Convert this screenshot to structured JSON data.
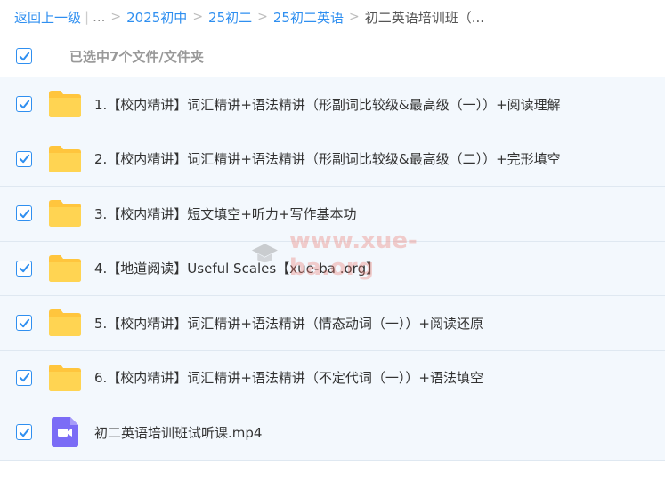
{
  "breadcrumb": {
    "back_label": "返回上一级",
    "pipe": "|",
    "ellipsis": "...",
    "separator": ">",
    "items": [
      "2025初中",
      "25初二",
      "25初二英语"
    ],
    "current": "初二英语培训班（..."
  },
  "selection": {
    "text": "已选中7个文件/文件夹",
    "checked": true
  },
  "files": [
    {
      "name": "1.【校内精讲】词汇精讲+语法精讲（形副词比较级&最高级（一））+阅读理解",
      "type": "folder",
      "checked": true
    },
    {
      "name": "2.【校内精讲】词汇精讲+语法精讲（形副词比较级&最高级（二））+完形填空",
      "type": "folder",
      "checked": true
    },
    {
      "name": "3.【校内精讲】短文填空+听力+写作基本功",
      "type": "folder",
      "checked": true
    },
    {
      "name": "4.【地道阅读】Useful Scales【xue-ba .org】",
      "type": "folder",
      "checked": true
    },
    {
      "name": "5.【校内精讲】词汇精讲+语法精讲（情态动词（一））+阅读还原",
      "type": "folder",
      "checked": true
    },
    {
      "name": "6.【校内精讲】词汇精讲+语法精讲（不定代词（一））+语法填空",
      "type": "folder",
      "checked": true
    },
    {
      "name": "初二英语培训班试听课.mp4",
      "type": "video",
      "checked": true
    }
  ],
  "watermark": {
    "text": "www.xue-ba.org",
    "icon": "graduation-cap-icon"
  },
  "colors": {
    "accent": "#2f8ff0",
    "folder": "#ffd04b",
    "video": "#7b6cf6",
    "row_bg": "#f3f8fd"
  }
}
